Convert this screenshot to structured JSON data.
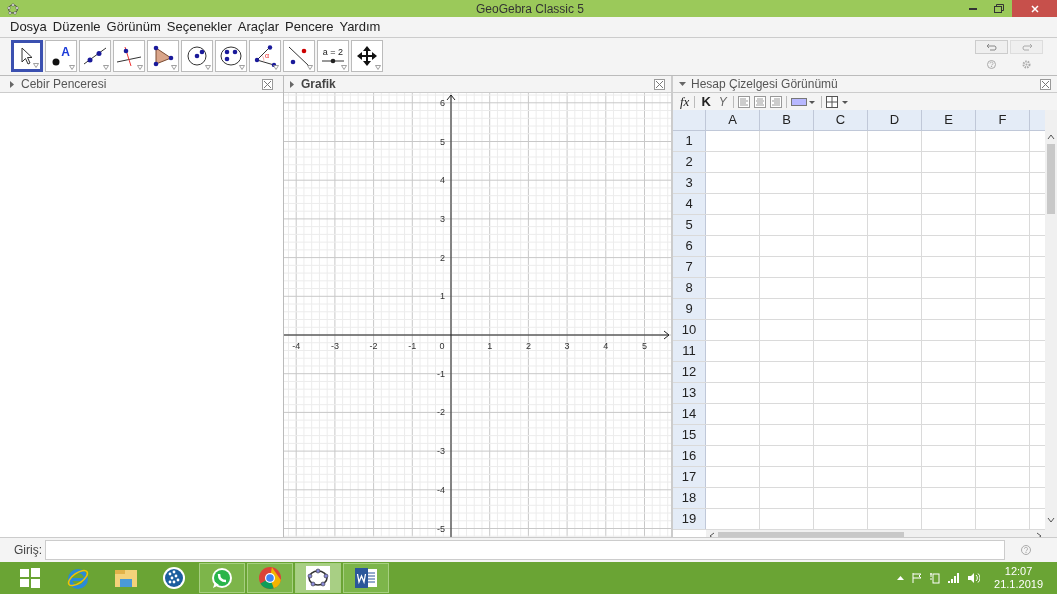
{
  "window": {
    "title": "GeoGebra Classic 5"
  },
  "menu": [
    "Dosya",
    "Düzenle",
    "Görünüm",
    "Seçenekler",
    "Araçlar",
    "Pencere",
    "Yardım"
  ],
  "tools": [
    {
      "kind": "move",
      "selected": true
    },
    {
      "kind": "point",
      "selected": false,
      "text": "A"
    },
    {
      "kind": "line",
      "selected": false
    },
    {
      "kind": "perpendicular",
      "selected": false
    },
    {
      "kind": "polygon",
      "selected": false
    },
    {
      "kind": "circle",
      "selected": false
    },
    {
      "kind": "conic",
      "selected": false
    },
    {
      "kind": "angle",
      "selected": false,
      "text": "α"
    },
    {
      "kind": "reflect",
      "selected": false
    },
    {
      "kind": "slider",
      "selected": false,
      "text": "a = 2"
    },
    {
      "kind": "pan",
      "selected": false
    }
  ],
  "algebra": {
    "title": "Cebir Penceresi"
  },
  "graphics": {
    "title": "Grafik",
    "x_labels": [
      "-4",
      "-3",
      "-2",
      "-1",
      "1",
      "2",
      "3",
      "4",
      "5"
    ],
    "y_labels": [
      "6",
      "5",
      "4",
      "3",
      "2",
      "1",
      "-1",
      "-2",
      "-3",
      "-4",
      "-5"
    ],
    "origin_label": "0"
  },
  "spreadsheet": {
    "title": "Hesap Çizelgesi Görünümü",
    "toolbar": [
      {
        "kind": "function",
        "text": "fx"
      },
      {
        "kind": "bold",
        "text": "K"
      },
      {
        "kind": "italic",
        "text": "Y"
      },
      {
        "kind": "align-left"
      },
      {
        "kind": "align-center"
      },
      {
        "kind": "align-right"
      },
      {
        "kind": "color"
      },
      {
        "kind": "border"
      }
    ],
    "columns": [
      "A",
      "B",
      "C",
      "D",
      "E",
      "F"
    ],
    "rows": [
      "1",
      "2",
      "3",
      "4",
      "5",
      "6",
      "7",
      "8",
      "9",
      "10",
      "11",
      "12",
      "13",
      "14",
      "15",
      "16",
      "17",
      "18",
      "19"
    ]
  },
  "input_bar": {
    "label": "Giriş:"
  },
  "taskbar": {
    "apps": [
      {
        "kind": "start",
        "running": false,
        "selected": false
      },
      {
        "kind": "ie",
        "running": false,
        "selected": false
      },
      {
        "kind": "explorer",
        "running": false,
        "selected": false
      },
      {
        "kind": "dots",
        "running": false,
        "selected": false
      },
      {
        "kind": "whatsapp",
        "running": true,
        "selected": false
      },
      {
        "kind": "chrome",
        "running": true,
        "selected": false
      },
      {
        "kind": "geogebra",
        "running": true,
        "selected": true
      },
      {
        "kind": "word",
        "running": true,
        "selected": false
      }
    ],
    "time": "12:07",
    "date": "21.1.2019"
  }
}
